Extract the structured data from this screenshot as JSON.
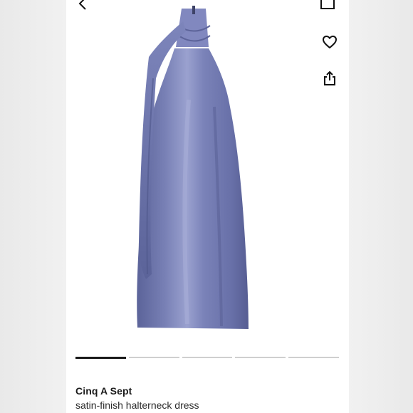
{
  "product": {
    "brand": "Cinq A Sept",
    "description": "satin-finish halterneck dress",
    "color_hex": "#6d76ad"
  },
  "carousel": {
    "total": 5,
    "active_index": 0
  },
  "icons": {
    "back": "chevron-left-icon",
    "bag": "shopping-bag-icon",
    "favorite": "heart-icon",
    "share": "share-icon"
  }
}
